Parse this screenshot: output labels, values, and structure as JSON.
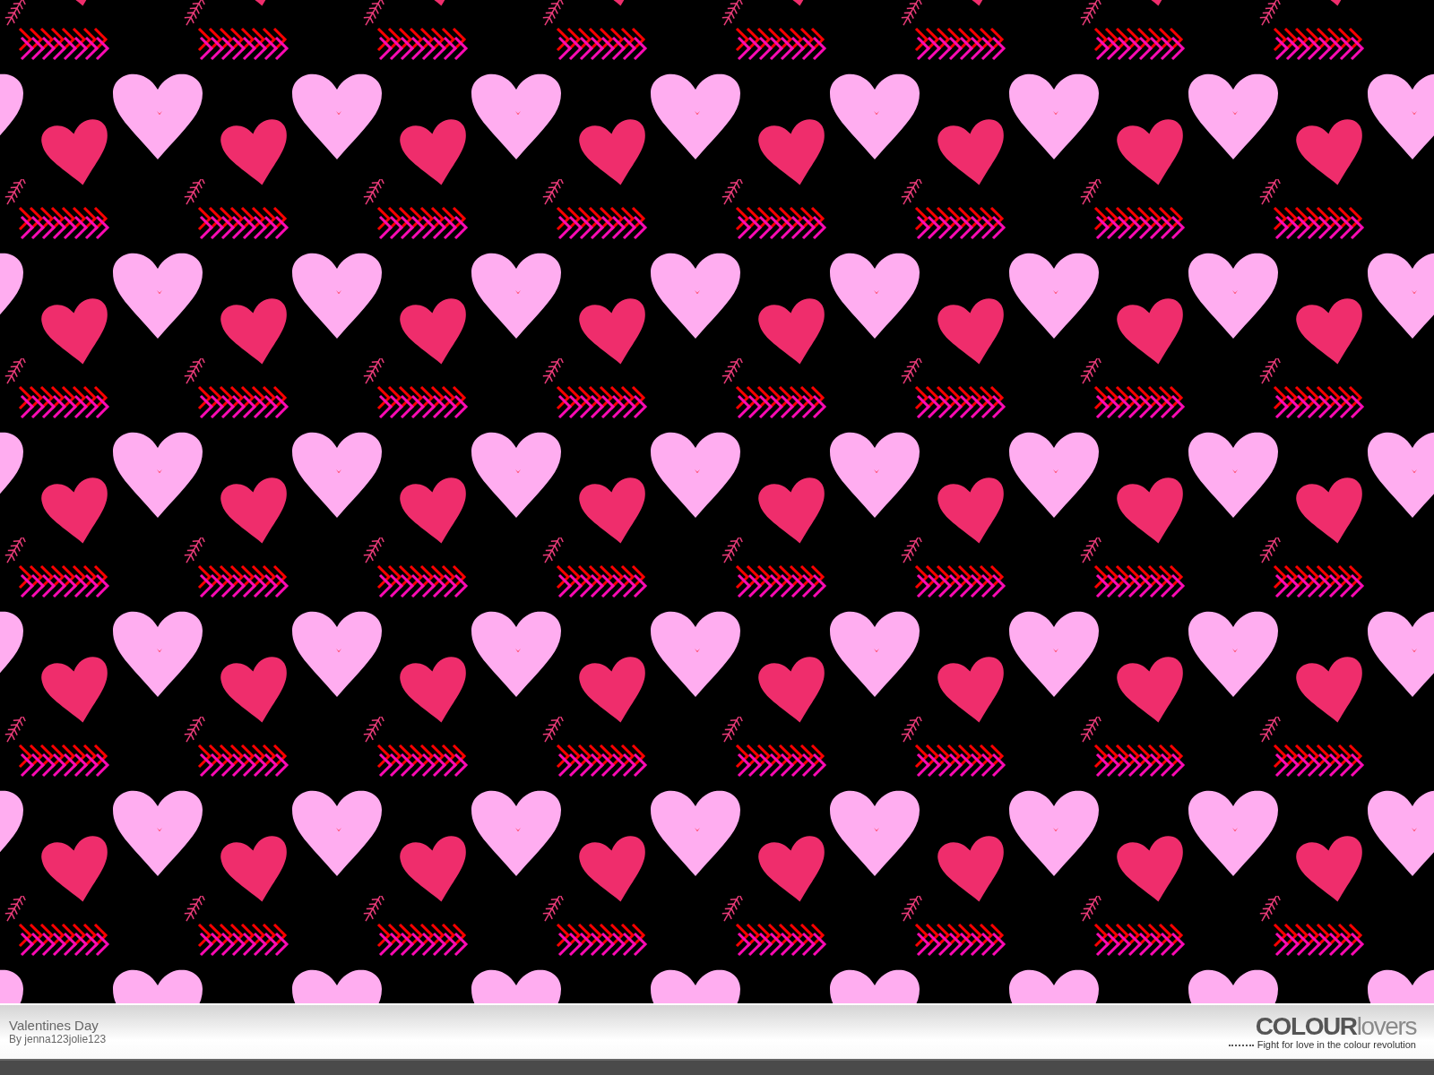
{
  "pattern": {
    "title": "Valentines Day",
    "author": "By jenna123jolie123"
  },
  "logo": {
    "strong": "COLOUR",
    "light": "lovers",
    "tagline": "Fight for love in the colour revolution"
  }
}
